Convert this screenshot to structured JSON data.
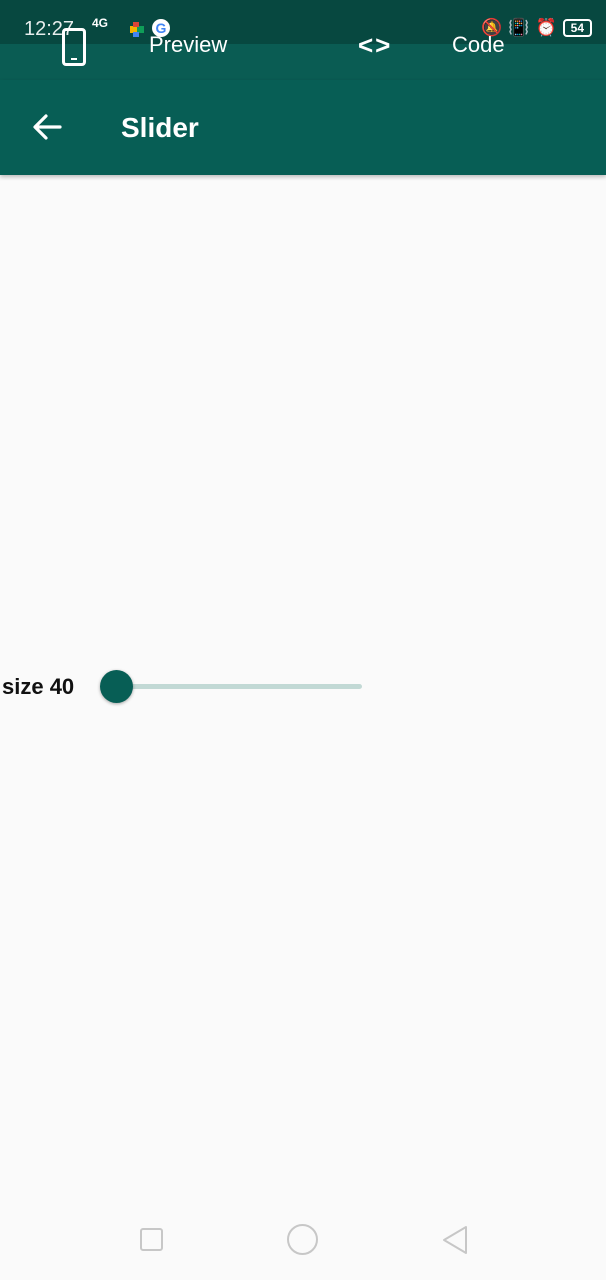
{
  "status_bar": {
    "time": "12:27",
    "signal": "4G",
    "battery": "54"
  },
  "preview_bar": {
    "preview_label": "Preview",
    "code_label": "Code",
    "code_glyph": "<>"
  },
  "app_bar": {
    "title": "Slider"
  },
  "slider": {
    "label": "size 40",
    "value": 40,
    "min": 40,
    "max": 100
  },
  "colors": {
    "primary": "#075e55",
    "status_bar": "#074840",
    "track_inactive": "#c2d9d5",
    "background": "#fafafa"
  }
}
